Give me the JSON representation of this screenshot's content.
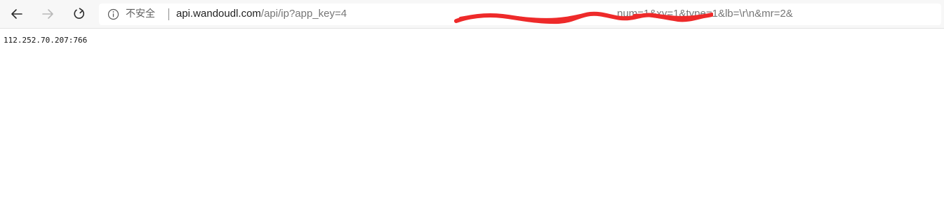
{
  "browser": {
    "security_label": "不安全",
    "url_host": "api.wandoudl.com",
    "url_path": "/api/ip?app_key=4",
    "url_tail": "num=1&xy=1&type=1&lb=\\r\\n&mr=2&"
  },
  "icons": {
    "back": "back-arrow-icon",
    "forward": "forward-arrow-icon",
    "reload": "reload-icon",
    "info": "info-icon"
  },
  "colors": {
    "redaction": "#ee2a2a",
    "toolbar_bg": "#f7f7f7"
  },
  "page": {
    "body_text": "112.252.70.207:766"
  }
}
